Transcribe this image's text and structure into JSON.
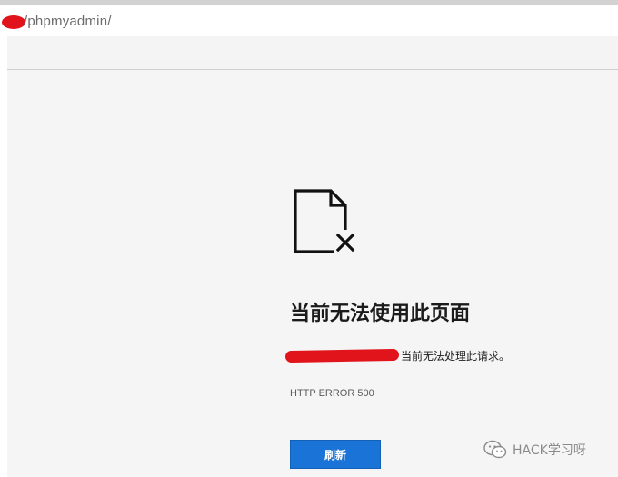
{
  "address_bar": {
    "url_path": "/phpmyadmin/"
  },
  "error_page": {
    "icon": "file-error-icon",
    "title": "当前无法使用此页面",
    "description": "当前无法处理此请求。",
    "error_code": "HTTP ERROR 500",
    "refresh_label": "刷新"
  },
  "watermark": {
    "icon": "wechat-icon",
    "text": "HACK学习呀"
  },
  "colors": {
    "accent_button": "#1a73d6",
    "redaction": "#e0141a",
    "page_background": "#f5f5f5"
  }
}
